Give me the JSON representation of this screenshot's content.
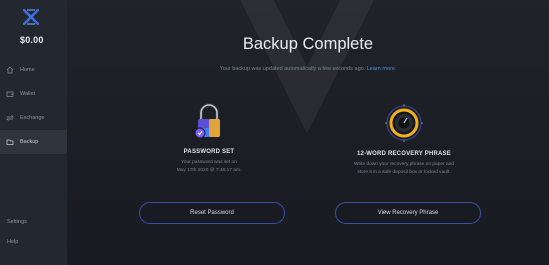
{
  "sidebar": {
    "balance": "$0.00",
    "items": [
      {
        "label": "Home",
        "icon": "home-icon"
      },
      {
        "label": "Wallet",
        "icon": "wallet-icon"
      },
      {
        "label": "Exchange",
        "icon": "exchange-icon"
      },
      {
        "label": "Backup",
        "icon": "backup-icon",
        "active": true
      }
    ],
    "bottom": [
      {
        "label": "Settings"
      },
      {
        "label": "Help"
      }
    ]
  },
  "main": {
    "title": "Backup Complete",
    "subtitle": "Your backup was updated automatically a few seconds ago.",
    "learn_more": "Learn more.",
    "password_card": {
      "title": "PASSWORD SET",
      "desc_line1": "Your password was set on",
      "desc_line2": "May 17th 2020 @ 7:46:17 am.",
      "button": "Reset Password",
      "icon": "lock-icon"
    },
    "phrase_card": {
      "title": "12-WORD RECOVERY PHRASE",
      "desc_line1": "Write down your recovery phrase on paper and",
      "desc_line2": "store it in a safe deposit box or locked vault.",
      "button": "View Recovery Phrase",
      "icon": "vault-dial-icon"
    }
  },
  "colors": {
    "sidebar_bg": "#232730",
    "main_bg": "#1b1e24",
    "accent_blue": "#3a4fa8",
    "link": "#5b8dd8",
    "logo_blue": "#3c6fe0",
    "dial_ring": "#f2b01c"
  }
}
